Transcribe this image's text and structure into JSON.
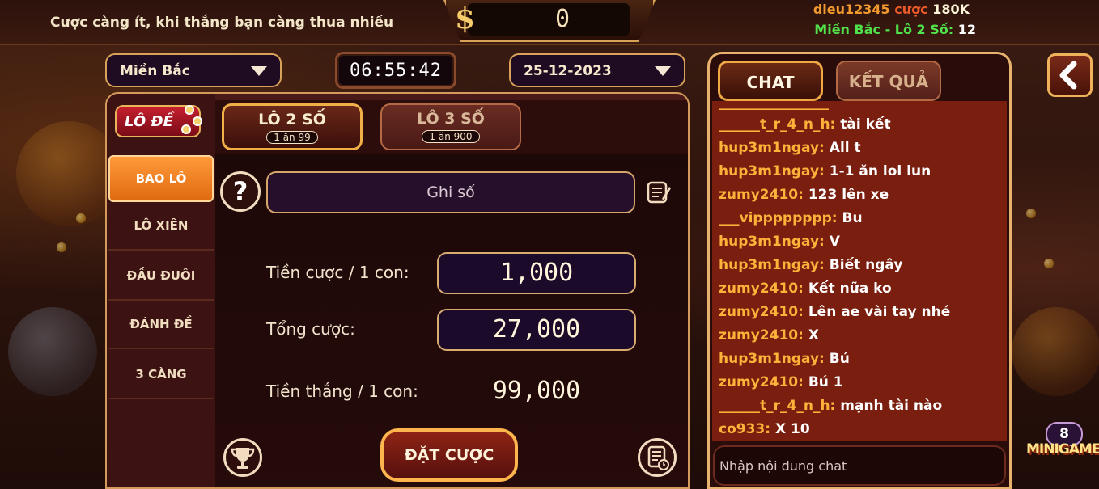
{
  "header": {
    "slogan": "Cược càng ít, khi thắng bạn càng thua nhiều",
    "jackpot_symbol": "$",
    "jackpot_value": "0",
    "user": {
      "name": "dieu12345",
      "bet_word": "cược",
      "bet_amount": "180K"
    },
    "region_status": {
      "label": "Miền Bắc - Lô 2 Số:",
      "count": "12"
    }
  },
  "filters": {
    "region": "Miền Bắc",
    "timer": "06:55:42",
    "date": "25-12-2023"
  },
  "sidebar": {
    "logo": "LÔ ĐỀ",
    "items": [
      {
        "label": "BAO LÔ",
        "active": true
      },
      {
        "label": "LÔ XIÊN",
        "active": false
      },
      {
        "label": "ĐẦU ĐUÔI",
        "active": false
      },
      {
        "label": "ĐÁNH ĐỀ",
        "active": false
      },
      {
        "label": "3 CÀNG",
        "active": false
      }
    ]
  },
  "tabs": [
    {
      "title": "LÔ 2 SỐ",
      "sub": "1 ăn 99",
      "active": true
    },
    {
      "title": "LÔ 3 SỐ",
      "sub": "1 ăn 900",
      "active": false
    }
  ],
  "form": {
    "help": "?",
    "number_placeholder": "Ghi số",
    "bet_per_label": "Tiền cược / 1 con:",
    "bet_per_value": "1,000",
    "total_label": "Tổng cược:",
    "total_value": "27,000",
    "win_label": "Tiền thắng / 1 con:",
    "win_value": "99,000",
    "submit_label": "ĐẶT CƯỢC"
  },
  "chat": {
    "tabs": [
      "CHAT",
      "KẾT QUẢ"
    ],
    "partial_top": "________________",
    "messages": [
      {
        "user": "______t_r_4_n_h:",
        "text": "tài kết"
      },
      {
        "user": "hup3m1ngay:",
        "text": "All t"
      },
      {
        "user": "hup3m1ngay:",
        "text": "1-1 ăn lol lun"
      },
      {
        "user": "zumy2410:",
        "text": "123 lên xe"
      },
      {
        "user": "___vipppppppp:",
        "text": "Bu"
      },
      {
        "user": "hup3m1ngay:",
        "text": "V"
      },
      {
        "user": "hup3m1ngay:",
        "text": "Biết ngây"
      },
      {
        "user": "zumy2410:",
        "text": "Kết nữa ko"
      },
      {
        "user": "zumy2410:",
        "text": "Lên ae vài tay nhé"
      },
      {
        "user": "zumy2410:",
        "text": "X"
      },
      {
        "user": "hup3m1ngay:",
        "text": "Bú"
      },
      {
        "user": "zumy2410:",
        "text": "Bú 1"
      },
      {
        "user": "______t_r_4_n_h:",
        "text": "mạnh tài nào"
      },
      {
        "user": "co933:",
        "text": "X 10"
      }
    ],
    "input_placeholder": "Nhập nội dung chat"
  },
  "minigame": {
    "badge": "8",
    "label": "MINIGAME"
  },
  "colors": {
    "accent_gold": "#d9a25a",
    "chat_user": "#ffb13a",
    "active_orange": "#ff9a3a",
    "region_green": "#4fe24a"
  }
}
